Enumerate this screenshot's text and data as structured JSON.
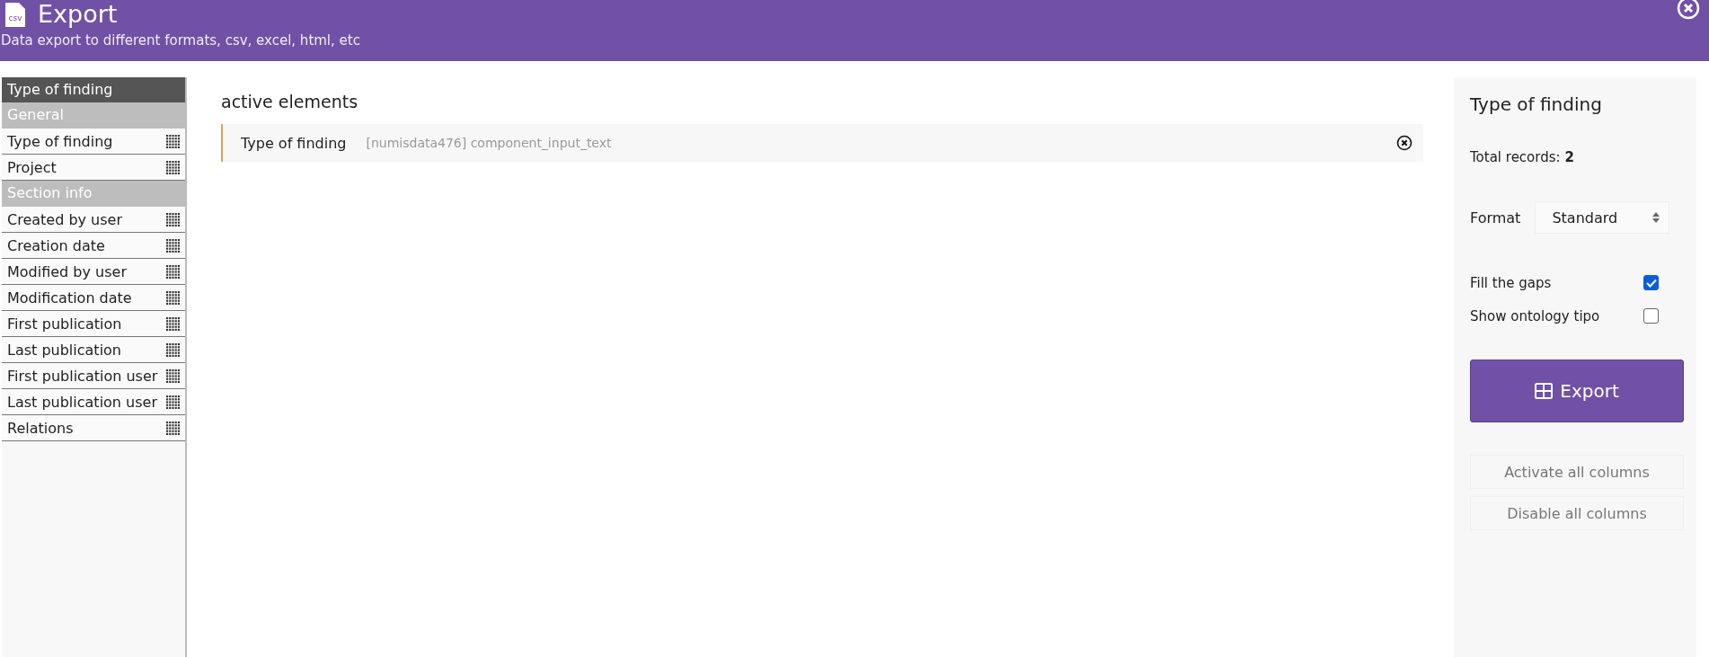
{
  "header": {
    "title": "Export",
    "subtitle": "Data export to different formats, csv, excel, html, etc",
    "icon_label": "csv"
  },
  "sidebar": {
    "title": "Type of finding",
    "sections": [
      {
        "label": "General",
        "items": [
          {
            "label": "Type of finding"
          },
          {
            "label": "Project"
          }
        ]
      },
      {
        "label": "Section info",
        "items": [
          {
            "label": "Created by user"
          },
          {
            "label": "Creation date"
          },
          {
            "label": "Modified by user"
          },
          {
            "label": "Modification date"
          },
          {
            "label": "First publication"
          },
          {
            "label": "Last publication"
          },
          {
            "label": "First publication user"
          },
          {
            "label": "Last publication user"
          },
          {
            "label": "Relations"
          }
        ]
      }
    ]
  },
  "active": {
    "title": "active elements",
    "elements": [
      {
        "label": "Type of finding",
        "info": "[numisdata476] component_input_text"
      }
    ]
  },
  "panel": {
    "title": "Type of finding",
    "total_label": "Total records:",
    "total_value": "2",
    "format_label": "Format",
    "format_value": "Standard",
    "options": [
      {
        "label": "Fill the gaps",
        "checked": true
      },
      {
        "label": "Show ontology tipo",
        "checked": false
      }
    ],
    "export_label": "Export",
    "activate_label": "Activate all columns",
    "disable_label": "Disable all columns"
  }
}
